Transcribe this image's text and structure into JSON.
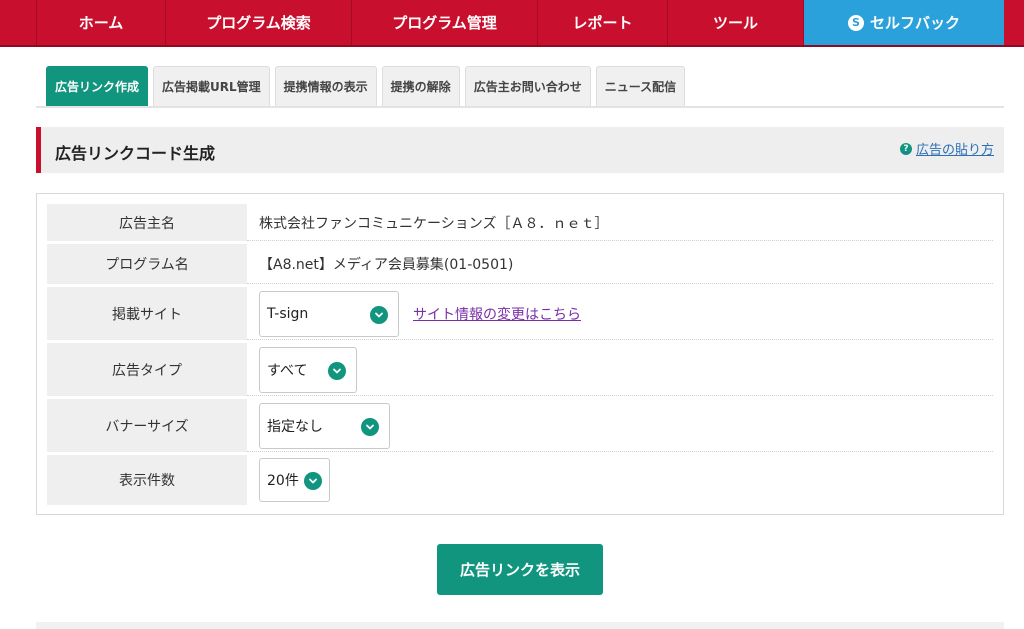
{
  "nav": {
    "items": [
      {
        "label": "ホーム"
      },
      {
        "label": "プログラム検索"
      },
      {
        "label": "プログラム管理"
      },
      {
        "label": "レポート"
      },
      {
        "label": "ツール"
      },
      {
        "label": "セルフバック",
        "icon": "self-back-icon"
      }
    ],
    "self_icon_char": "S"
  },
  "tabs": [
    {
      "label": "広告リンク作成",
      "active": true
    },
    {
      "label": "広告掲載URL管理"
    },
    {
      "label": "提携情報の表示"
    },
    {
      "label": "提携の解除"
    },
    {
      "label": "広告主お問い合わせ"
    },
    {
      "label": "ニュース配信"
    }
  ],
  "section": {
    "title": "広告リンクコード生成",
    "help_icon_char": "?",
    "help_link": "広告の貼り方"
  },
  "form": {
    "advertiser": {
      "label": "広告主名",
      "value": "株式会社ファンコミュニケーションズ［Ａ８．ｎｅｔ］"
    },
    "program": {
      "label": "プログラム名",
      "value": "【A8.net】メディア会員募集(01-0501)"
    },
    "site": {
      "label": "掲載サイト",
      "value": "T-sign",
      "link": "サイト情報の変更はこちら"
    },
    "ad_type": {
      "label": "広告タイプ",
      "value": "すべて"
    },
    "banner_size": {
      "label": "バナーサイズ",
      "value": "指定なし"
    },
    "per_page": {
      "label": "表示件数",
      "value": "20件"
    }
  },
  "submit_label": "広告リンクを表示",
  "colors": {
    "brand_red": "#c8102e",
    "accent_green": "#11957e",
    "self_back_blue": "#2ba1dc"
  }
}
